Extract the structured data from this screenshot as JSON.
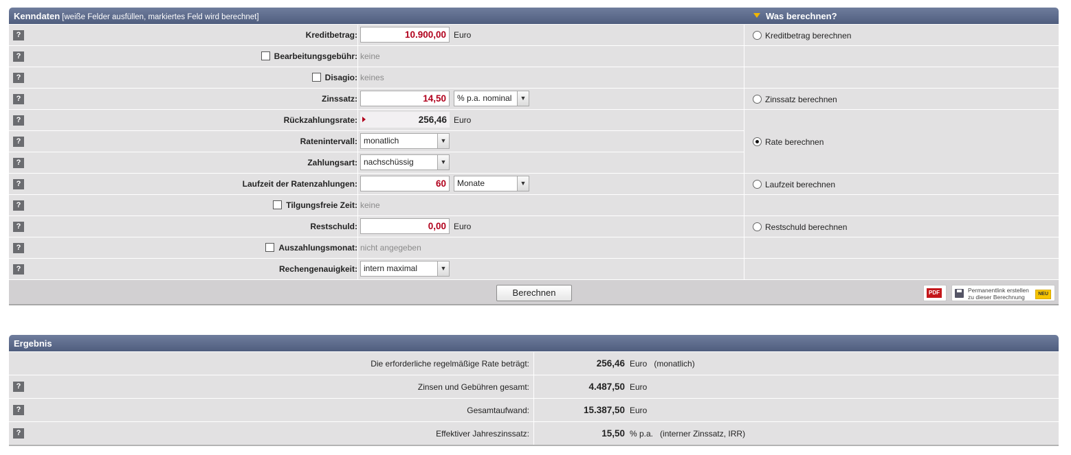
{
  "kenndaten": {
    "title": "Kenndaten",
    "subtitle": "[weiße Felder ausfüllen, markiertes Feld wird berechnet]",
    "help_glyph": "?",
    "rows": [
      {
        "label": "Kreditbetrag:",
        "value": "10.900,00",
        "unit": "Euro"
      },
      {
        "label": "Bearbeitungsgebühr:",
        "text": "keine"
      },
      {
        "label": "Disagio:",
        "text": "keines"
      },
      {
        "label": "Zinssatz:",
        "value": "14,50",
        "select": "% p.a. nominal"
      },
      {
        "label": "Rückzahlungsrate:",
        "value": "256,46",
        "unit": "Euro"
      },
      {
        "label": "Ratenintervall:",
        "select": "monatlich"
      },
      {
        "label": "Zahlungsart:",
        "select": "nachschüssig"
      },
      {
        "label": "Laufzeit der Ratenzahlungen:",
        "value": "60",
        "select": "Monate"
      },
      {
        "label": "Tilgungsfreie Zeit:",
        "text": "keine"
      },
      {
        "label": "Restschuld:",
        "value": "0,00",
        "unit": "Euro"
      },
      {
        "label": "Auszahlungsmonat:",
        "text": "nicht angegeben"
      },
      {
        "label": "Rechengenauigkeit:",
        "select": "intern maximal"
      }
    ],
    "select_arrow": "▼"
  },
  "was_berechnen": {
    "title": "Was berechnen?",
    "options": [
      {
        "label": "Kreditbetrag berechnen",
        "selected": false
      },
      {
        "label": "Zinssatz berechnen",
        "selected": false
      },
      {
        "label": "Rate berechnen",
        "selected": true
      },
      {
        "label": "Laufzeit berechnen",
        "selected": false
      },
      {
        "label": "Restschuld berechnen",
        "selected": false
      }
    ]
  },
  "actions": {
    "berechnen_label": "Berechnen",
    "pdf_label": "PDF",
    "permalink_line1": "Permanentlink erstellen",
    "permalink_line2": "zu dieser Berechnung",
    "neu_badge": "NEU"
  },
  "ergebnis": {
    "title": "Ergebnis",
    "rows": [
      {
        "label": "Die erforderliche regelmäßige Rate beträgt:",
        "value": "256,46",
        "unit": "Euro",
        "note": "(monatlich)"
      },
      {
        "label": "Zinsen und Gebühren gesamt:",
        "value": "4.487,50",
        "unit": "Euro"
      },
      {
        "label": "Gesamtaufwand:",
        "value": "15.387,50",
        "unit": "Euro"
      },
      {
        "label": "Effektiver Jahreszinssatz:",
        "value": "15,50",
        "unit": "% p.a.",
        "note": "(interner Zinssatz, IRR)"
      }
    ]
  },
  "colors": {
    "header_bg": "#5a6888",
    "row_bg": "#e2e1e2",
    "input_value": "#b1001c",
    "help_bg": "#6b6c70",
    "triangle": "#f2b600"
  }
}
